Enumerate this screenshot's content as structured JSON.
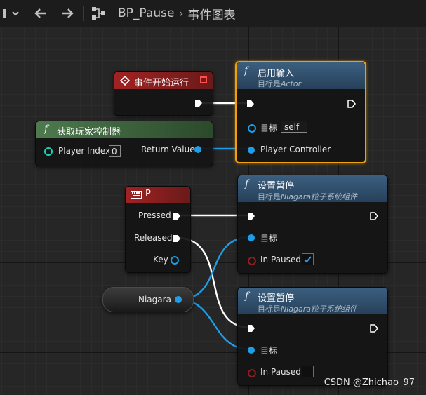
{
  "toolbar": {
    "breadcrumb": [
      "BP_Pause",
      "事件图表"
    ]
  },
  "nodes": {
    "begin_play": {
      "title": "事件开始运行"
    },
    "get_player_controller": {
      "title": "获取玩家控制器",
      "player_index_label": "Player Index",
      "player_index_value": "0",
      "return_label": "Return Value"
    },
    "enable_input": {
      "title": "启用输入",
      "subtitle_prefix": "目标是",
      "subtitle_target": "Actor",
      "target_label": "目标",
      "target_value": "self",
      "pc_label": "Player Controller"
    },
    "key_p": {
      "title": "P",
      "pressed": "Pressed",
      "released": "Released",
      "key": "Key"
    },
    "niagara_var": {
      "label": "Niagara"
    },
    "set_paused_1": {
      "title": "设置暂停",
      "subtitle_prefix": "目标是",
      "subtitle_target": "Niagara粒子系统组件",
      "target_label": "目标",
      "paused_label": "In Paused",
      "paused_checked": true
    },
    "set_paused_2": {
      "title": "设置暂停",
      "subtitle_prefix": "目标是",
      "subtitle_target": "Niagara粒子系统组件",
      "target_label": "目标",
      "paused_label": "In Paused",
      "paused_checked": false
    }
  },
  "watermark": "CSDN @Zhichao_97",
  "colors": {
    "event_header": "#8a1c1c",
    "pure_function_header": "#3e6b3e",
    "function_header": "#2d4a66",
    "selection": "#f0a10a",
    "object_pin": "#1e9ee8",
    "bool_pin": "#8e1d1d",
    "int_pin": "#1fd4b2"
  },
  "icons": [
    "menu-icon",
    "chevron-down-icon",
    "back-arrow-icon",
    "forward-arrow-icon",
    "graph-icon",
    "event-diamond-icon",
    "function-icon",
    "keyboard-icon",
    "checkmark-icon"
  ]
}
